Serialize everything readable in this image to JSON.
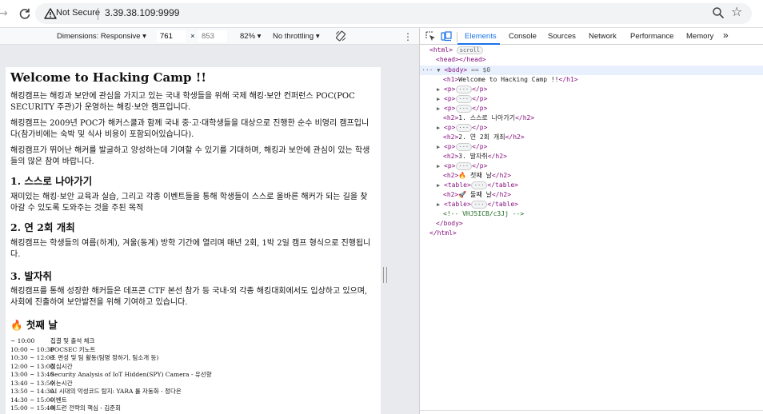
{
  "browser": {
    "security_label": "Not Secure",
    "url": "3.39.38.109:9999"
  },
  "device_toolbar": {
    "dimensions_label": "Dimensions: Responsive",
    "width_value": "761",
    "times": "×",
    "height_placeholder": "853",
    "zoom": "82%",
    "throttle": "No throttling"
  },
  "devtools": {
    "tabs": [
      "Elements",
      "Console",
      "Sources",
      "Network",
      "Performance",
      "Memory"
    ],
    "more": "»",
    "active_tab": "Elements",
    "dom": {
      "html_open": "<html>",
      "scroll_pill": "scroll",
      "head": "<head></head>",
      "body_open": "<body>",
      "body_eq": "== $0",
      "h1_open": "<h1>",
      "h1_text": "Welcome to Hacking Camp !!",
      "h1_close": "</h1>",
      "p_open": "<p>",
      "ellipsis": "···",
      "p_close": "</p>",
      "h2_open": "<h2>",
      "h2_close": "</h2>",
      "table_open": "<table>",
      "table_close": "</table>",
      "h2_1": "1. 스스로 나아가기",
      "h2_2": "2. 연 2회 개최",
      "h2_3": "3. 발자취",
      "h2_4": "🔥 첫째 날",
      "h2_5": "🚀 둘째 날",
      "comment": "<!-- VHJ5ICB/c3Jj -->",
      "body_close": "</body>",
      "html_close": "</html>"
    }
  },
  "page": {
    "title": "Welcome to Hacking Camp !!",
    "p1": "해킹캠프는 해킹과 보안에 관심을 가지고 있는 국내 학생들을 위해 국제 해킹·보안 컨퍼런스 POC(POC SECURITY 주관)가 운영하는 해킹·보안 캠프입니다.",
    "p2": "해킹캠프는 2009년 POC가 해커스쿨과 함께 국내 중·고·대학생들을 대상으로 진행한 순수 비영리 캠프입니다(참가비에는 숙박 및 식사 비용이 포함되어있습니다).",
    "p3": "해킹캠프가 뛰어난 해커를 발굴하고 양성하는데 기여할 수 있기를 기대하며, 해킹과 보안에 관심이 있는 학생들의 많은 참여 바랍니다.",
    "h2_1": "1. 스스로 나아가기",
    "p4": "재미있는 해킹·보안 교육과 실습, 그리고 각종 이벤트들을 통해 학생들이 스스로 올바른 해커가 되는 길을 찾아갈 수 있도록 도와주는 것을 주된 목적",
    "h2_2": "2. 연 2회 개최",
    "p5": "해킹캠프는 학생들의 여름(하계), 겨울(동계) 방학 기간에 열리며 매년 2회, 1박 2일 캠프 형식으로 진행됩니다.",
    "h2_3": "3. 발자취",
    "p6": "해킹캠프를 통해 성장한 해커들은 데프콘 CTF 본선 참가 등 국내·외 각종 해킹대회에서도 입상하고 있으며, 사회에 진출하여 보안발전을 위해 기여하고 있습니다.",
    "h2_4": "🔥 첫째 날",
    "schedule": [
      {
        "time": "~ 10:00",
        "event": "집결 및 출석 체크"
      },
      {
        "time": "10:00 ~ 10:30",
        "event": "POCSEC 키노트"
      },
      {
        "time": "10:30 ~ 12:00",
        "event": "조 편성 및 팀 활동(팀명 정하기, 팀소개 등)"
      },
      {
        "time": "12:00 ~ 13:00",
        "event": "점심시간"
      },
      {
        "time": "13:00 ~ 13:40",
        "event": "Security Analysis of IoT Hidden(SPY) Camera - 유선향"
      },
      {
        "time": "13:40 ~ 13:50",
        "event": "쉬는시간"
      },
      {
        "time": "13:50 ~ 14:30",
        "event": "AI 시대의 악성코드 탐지: YARA 룰 자동화 - 정다은"
      },
      {
        "time": "14:30 ~ 15:00",
        "event": "이벤트"
      },
      {
        "time": "15:00 ~ 15:40",
        "event": "해드런 전략의 핵심 - 김준회"
      }
    ]
  }
}
